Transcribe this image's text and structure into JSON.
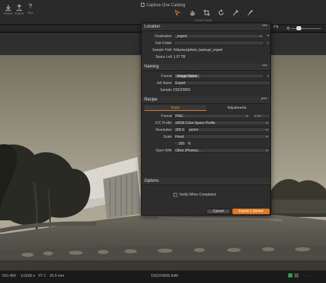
{
  "window": {
    "title": "Capture One Catalog"
  },
  "toolbar": {
    "import_label": "Import",
    "export_label": "Export",
    "tips_label": "Tips",
    "tips_glyph": "?",
    "cursor_tools_label": "Cursor Tools",
    "icons": [
      "import-icon",
      "export-icon",
      "help-icon",
      "select-cursor-icon",
      "pan-icon",
      "crop-icon",
      "rotate-icon",
      "picker-icon",
      "brush-icon"
    ]
  },
  "viewer_bar": {
    "fit_label": "Fit"
  },
  "dialog": {
    "location": {
      "title": "Location",
      "menu_glyph": "•••",
      "destination_label": "Destination",
      "destination_value": "_export",
      "subfolder_label": "Sub Folder",
      "subfolder_value": "",
      "sample_path_label": "Sample Path",
      "sample_path_value": "/Volumes/photo_backup/_export",
      "space_left_label": "Space Left",
      "space_left_value": "1.37 TB"
    },
    "naming": {
      "title": "Naming",
      "menu_glyph": "•••",
      "format_label": "Format",
      "format_token": "Image Name",
      "job_name_label": "Job Name",
      "job_name_value": "Export",
      "sample_label": "Sample",
      "sample_value": "DSCF0655"
    },
    "recipe": {
      "title": "Recipe",
      "help_glyph": "?",
      "menu_glyph": "•••",
      "tabs": [
        "Basic",
        "Adjustments"
      ],
      "format_label": "Format",
      "format_value": "PNG",
      "bit_depth_value": "8 bit",
      "icc_label": "ICC Profile",
      "icc_value": "sRGB Color Space Profile",
      "resolution_label": "Resolution",
      "resolution_value": "200.0",
      "resolution_unit": "px/cm",
      "scale_label": "Scale",
      "scale_value": "Fixed",
      "scale_percent": "100",
      "scale_percent_unit": "%",
      "open_with_label": "Open With",
      "open_with_value": "Other (Photos)..."
    },
    "options": {
      "title": "Options",
      "notify_label": "Notify When Completed",
      "notify_checked": false
    },
    "buttons": {
      "cancel": "Cancel",
      "export": "Export 1 Variant"
    }
  },
  "statusbar": {
    "iso": "ISO 400",
    "shutter": "1/1500 s",
    "aperture": "f/7.1",
    "focal": "20.5 mm",
    "filename": "DSCF0655.RAF",
    "label_colors": [
      "#2ea043",
      "#555555"
    ]
  },
  "colors": {
    "accent": "#e2822c",
    "export_button": "#e07b25"
  }
}
